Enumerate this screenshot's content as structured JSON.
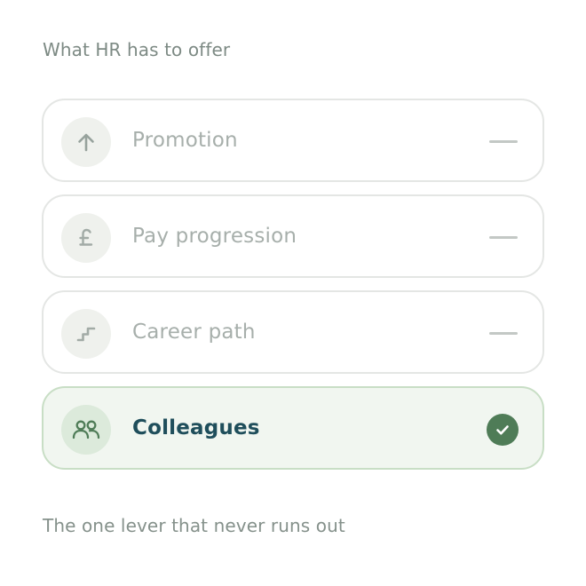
{
  "heading": "What HR has to offer",
  "options": [
    {
      "label": "Promotion",
      "icon": "arrow-up-icon",
      "selected": false
    },
    {
      "label": "Pay progression",
      "icon": "pound-icon",
      "selected": false
    },
    {
      "label": "Career path",
      "icon": "stairs-icon",
      "selected": false
    },
    {
      "label": "Colleagues",
      "icon": "people-icon",
      "selected": true
    }
  ],
  "footer": "The one lever that never runs out",
  "colors": {
    "selected_text": "#1f4e5b",
    "check_fill": "#4f7c57",
    "selected_background": "#f1f6f0",
    "unselected_text": "#a7afab"
  }
}
